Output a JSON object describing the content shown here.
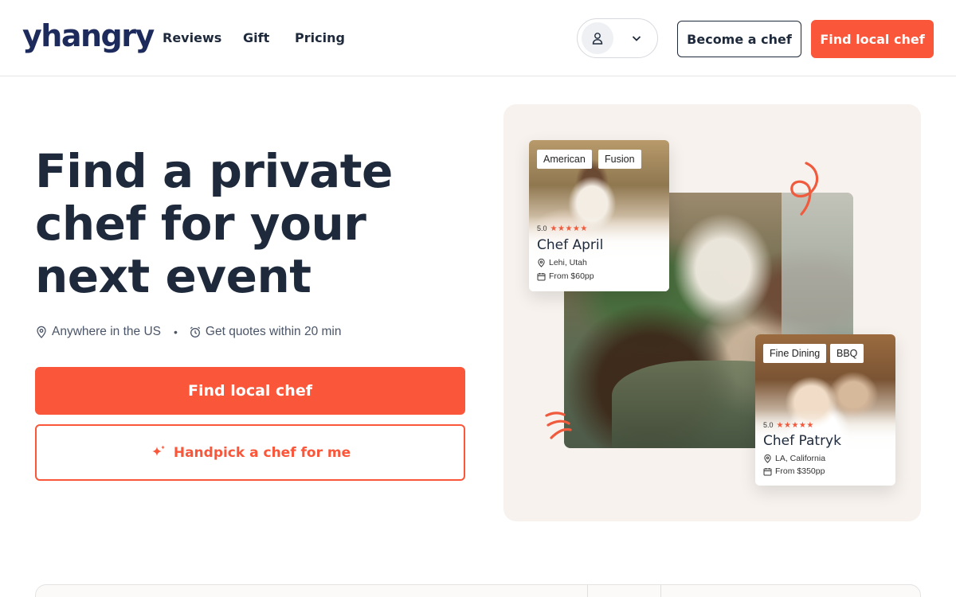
{
  "header": {
    "logo": "yhangry",
    "nav": {
      "reviews": "Reviews",
      "gift": "Gift",
      "pricing": "Pricing"
    },
    "become_chef": "Become a chef",
    "find_local_chef": "Find local chef"
  },
  "hero": {
    "title_lines": [
      "Find a private",
      "chef for your",
      "next event"
    ],
    "location": "Anywhere in the US",
    "separator": "•",
    "quotes": "Get quotes within 20 min",
    "cta_primary": "Find local chef",
    "cta_secondary": "Handpick a chef for me"
  },
  "cards": {
    "april": {
      "tags": [
        "American",
        "Fusion"
      ],
      "rating": "5.0",
      "stars": "★★★★★",
      "name": "Chef April",
      "location": "Lehi, Utah",
      "price": "From $60pp"
    },
    "patryk": {
      "tags": [
        "Fine Dining",
        "BBQ"
      ],
      "rating": "5.0",
      "stars": "★★★★★",
      "name": "Chef Patryk",
      "location": "LA, California",
      "price": "From $350pp"
    }
  },
  "colors": {
    "brand_orange": "#f9563a",
    "text_dark": "#1e2a3b",
    "logo_navy": "#1d2a5c",
    "panel_bg": "#f7f2ee"
  },
  "icons": {
    "account": "user-icon",
    "dropdown": "chevron-down-icon",
    "location": "map-pin-icon",
    "time": "alarm-clock-icon",
    "sparkle": "sparkle-icon",
    "price": "calendar-icon"
  }
}
